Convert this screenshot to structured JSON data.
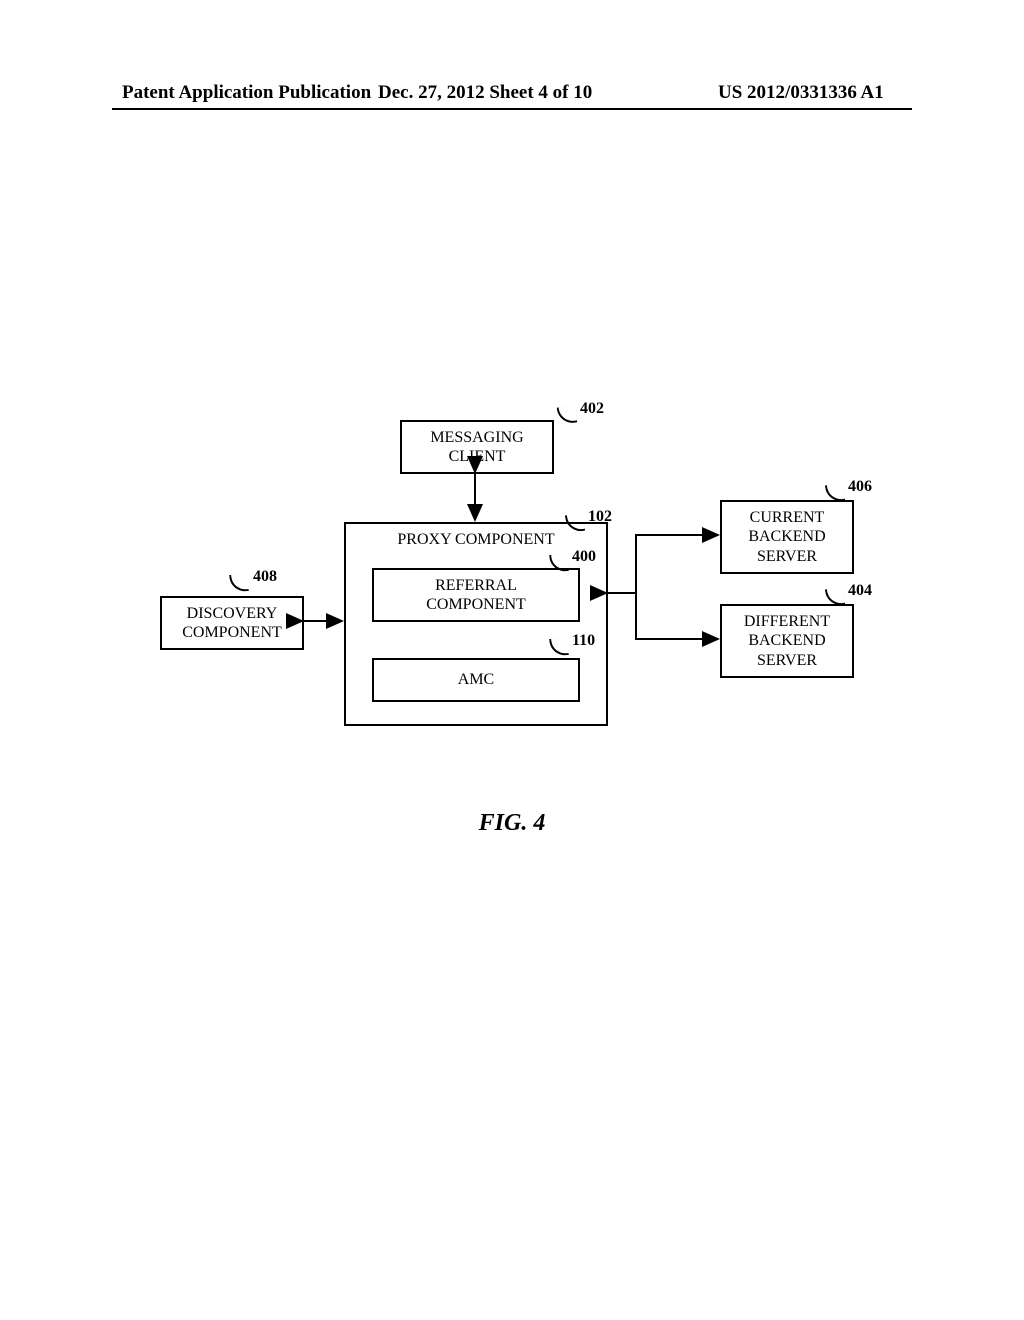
{
  "header": {
    "left": "Patent Application Publication",
    "center": "Dec. 27, 2012  Sheet 4 of 10",
    "right": "US 2012/0331336 A1"
  },
  "figure_caption": "FIG. 4",
  "boxes": {
    "messaging_client": "MESSAGING\nCLIENT",
    "proxy_component": "PROXY COMPONENT",
    "referral_component": "REFERRAL\nCOMPONENT",
    "amc": "AMC",
    "discovery_component": "DISCOVERY\nCOMPONENT",
    "current_backend_server": "CURRENT\nBACKEND\nSERVER",
    "different_backend_server": "DIFFERENT\nBACKEND\nSERVER"
  },
  "refs": {
    "messaging_client": "402",
    "proxy_component": "102",
    "referral_component": "400",
    "amc": "110",
    "discovery_component": "408",
    "current_backend_server": "406",
    "different_backend_server": "404"
  }
}
